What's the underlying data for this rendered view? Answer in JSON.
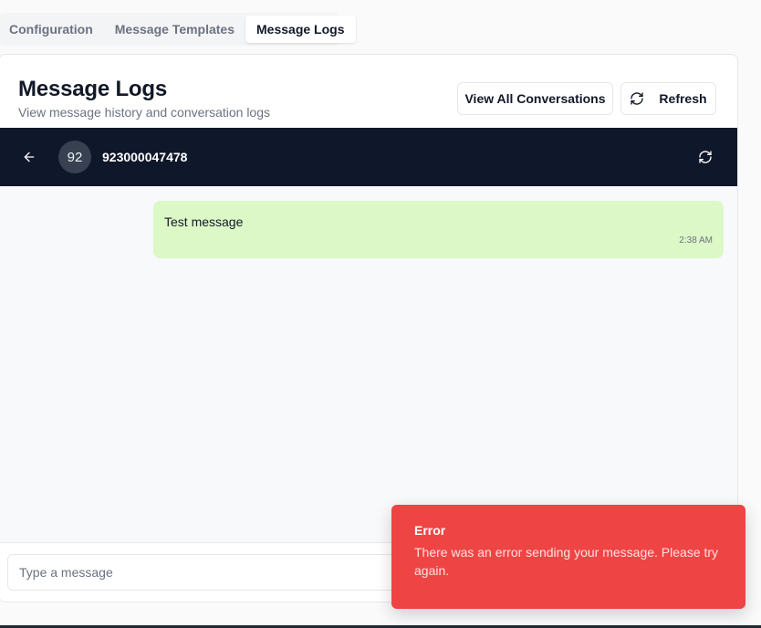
{
  "tabs": [
    {
      "label": "Configuration",
      "active": false
    },
    {
      "label": "Message Templates",
      "active": false
    },
    {
      "label": "Message Logs",
      "active": true
    }
  ],
  "card": {
    "title": "Message Logs",
    "subtitle": "View message history and conversation logs",
    "view_all_label": "View All Conversations",
    "refresh_label": "Refresh"
  },
  "chat": {
    "avatar_initials": "92",
    "contact_number": "923000047478",
    "header_color": "#0f172a",
    "icons": {
      "back": "arrow-left-icon",
      "refresh": "refresh-icon"
    }
  },
  "messages": [
    {
      "text": "Test message",
      "time": "2:38 AM",
      "direction": "outgoing",
      "bubble_color": "#dcf8c6"
    }
  ],
  "composer": {
    "placeholder": "Type a message"
  },
  "toast": {
    "title": "Error",
    "description": "There was an error sending your message. Please try again.",
    "color": "#ef4444"
  }
}
